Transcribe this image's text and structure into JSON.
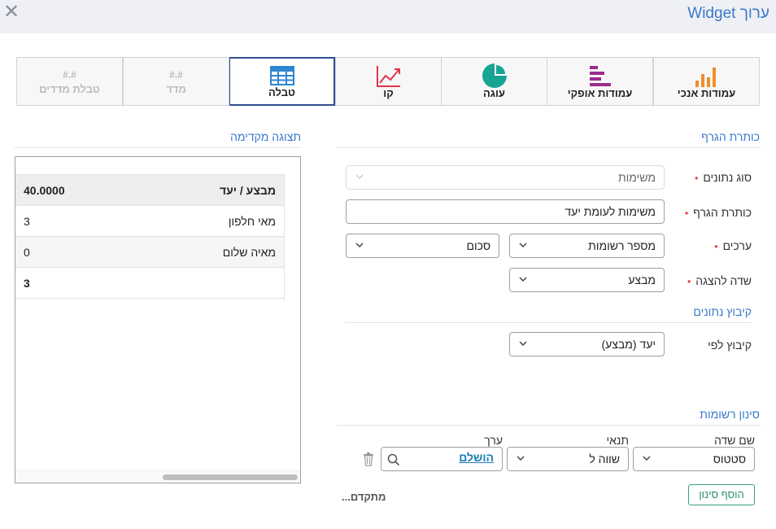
{
  "header": {
    "title": "ערוך Widget",
    "close_symbol": "✕"
  },
  "chart_types": [
    {
      "label": "עמודות אנכי",
      "icon": "vertical-bars-icon"
    },
    {
      "label": "עמודות אופקי",
      "icon": "horizontal-bars-icon"
    },
    {
      "label": "עוגה",
      "icon": "pie-icon"
    },
    {
      "label": "קו",
      "icon": "line-chart-icon"
    },
    {
      "label": "טבלה",
      "icon": "table-icon"
    },
    {
      "label": "מדד",
      "hash": "#.#"
    },
    {
      "label": "טבלת מדדים",
      "hash": "#.#"
    }
  ],
  "selected_type": "טבלה",
  "colors": {
    "accent": "#3a78c9",
    "required": "#e0343b",
    "selected_border": "#2f4f8e",
    "bars": "#ef8f2a",
    "hbars": "#9b2c8f",
    "pie": "#17a493",
    "line": "#e0344c",
    "table": "#2e86d1",
    "add_filter": "#2f8f6c"
  },
  "preview": {
    "title": "תצוגה מקדימה",
    "header": {
      "label": "מבצע / יעד",
      "value": "40.0000"
    },
    "rows": [
      {
        "label": "מאי חלפון",
        "value": "3"
      },
      {
        "label": "מאיה שלום",
        "value": "0"
      }
    ],
    "total": {
      "label": "",
      "value": "3"
    }
  },
  "chart_title_section": {
    "title": "כותרת הגרף",
    "data_type": {
      "label": "סוג נתונים",
      "value": "משימות"
    },
    "chart_title": {
      "label": "כותרת הגרף",
      "value": "משימות לעומת יעד"
    },
    "values": {
      "label": "ערכים",
      "field": "מספר רשומות",
      "aggregation": "סכום"
    },
    "display_field": {
      "label": "שדה להצגה",
      "value": "מבצע"
    }
  },
  "grouping_section": {
    "title": "קיבוץ נתונים",
    "group_by": {
      "label": "קיבוץ לפי",
      "value": "יעד (מבצע)"
    }
  },
  "filter_section": {
    "title": "סינון רשומות",
    "field_header": "שם שדה",
    "condition_header": "תנאי",
    "value_header": "ערך",
    "field": "סטטוס",
    "condition": "שווה ל",
    "value": "הושלם",
    "add_filter": "הוסף סינון",
    "advanced": "מתקדם..."
  }
}
